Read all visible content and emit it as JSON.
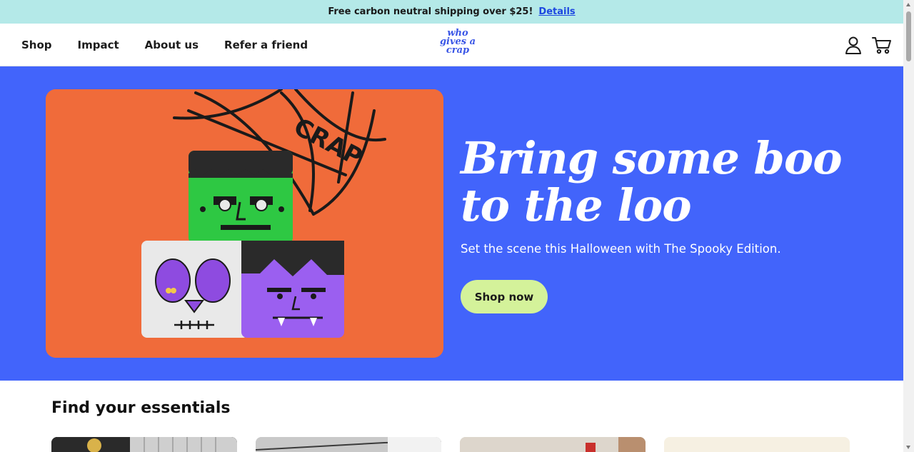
{
  "announcement": {
    "text": "Free carbon neutral shipping over $25!",
    "link": "Details"
  },
  "nav": {
    "items": [
      {
        "label": "Shop"
      },
      {
        "label": "Impact"
      },
      {
        "label": "About us"
      },
      {
        "label": "Refer a friend"
      }
    ],
    "logo_lines": [
      "who",
      "gives a",
      "crap"
    ],
    "icons": [
      "account-icon",
      "cart-icon"
    ]
  },
  "hero": {
    "title": "Bring some boo to the loo",
    "subtitle": "Set the scene this Halloween with The Spooky Edition.",
    "cta": "Shop now",
    "image_text": "CRAP"
  },
  "essentials": {
    "title": "Find your essentials"
  },
  "colors": {
    "announcement_bg": "#b4e9e8",
    "hero_bg": "#4264fb",
    "cta_bg": "#d4f29a",
    "link": "#1d47e0",
    "image_bg": "#f06b3a"
  }
}
